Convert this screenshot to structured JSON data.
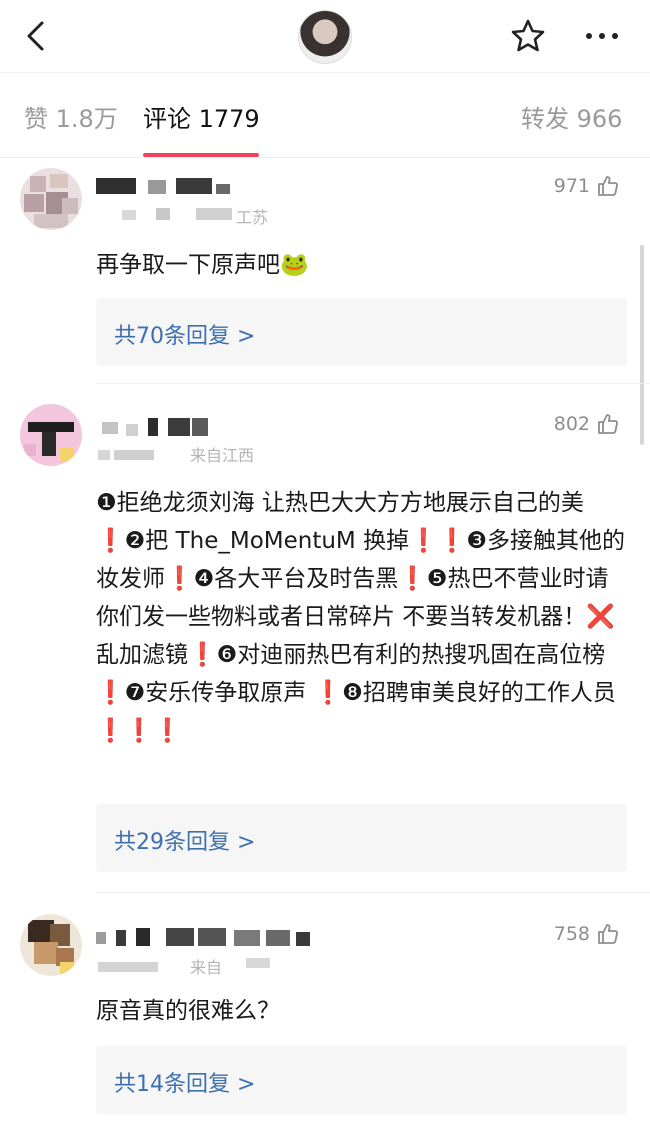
{
  "header": {
    "icons": [
      "back-icon",
      "avatar",
      "star-icon",
      "more-icon"
    ]
  },
  "tabs": [
    {
      "label": "赞 1.8万"
    },
    {
      "label": "评论 1779"
    },
    {
      "label": "转发 966"
    }
  ],
  "comments": [
    {
      "meta": "工苏",
      "likes": "971",
      "text": "再争取一下原声吧🐸",
      "reply_label": "共70条回复 >"
    },
    {
      "meta": "来自江西",
      "likes": "802",
      "text": "❶拒绝龙须刘海 让热巴大大方方地展示自己的美❗️❷把 The_MoMentuM 换掉❗️❗️❸多接触其他的妆发师❗️❹各大平台及时告黑❗️❺热巴不营业时请你们发一些物料或者日常碎片 不要当转发机器！❌乱加滤镜❗️❻对迪丽热巴有利的热搜巩固在高位榜❗️❼安乐传争取原声 ❗️❽招聘审美良好的工作人员❗️❗️❗️",
      "reply_label": "共29条回复 >"
    },
    {
      "meta": "来自",
      "likes": "758",
      "text": "原音真的很难么？",
      "reply_label": "共14条回复 >"
    }
  ],
  "colors": {
    "accent": "#f0445a",
    "link": "#3e6fb0"
  }
}
